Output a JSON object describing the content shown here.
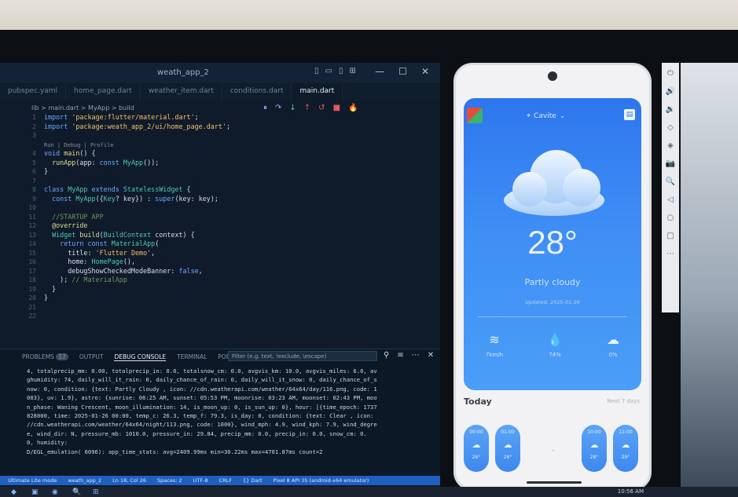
{
  "ide": {
    "title": "weath_app_2",
    "layout_icons": [
      "sidebar-left-icon",
      "panel-icon",
      "sidebar-right-icon",
      "layout-icon"
    ],
    "window_controls": [
      "—",
      "☐",
      "✕"
    ],
    "tabs": [
      "pubspec.yaml",
      "home_page.dart",
      "weather_item.dart",
      "conditions.dart",
      "main.dart"
    ],
    "breadcrumb": "lib > main.dart > MyApp > build",
    "debug_controls": [
      "⏸",
      "↷",
      "↓",
      "↑",
      "↺",
      "■",
      "🔥"
    ],
    "code_lines": [
      {
        "n": "1",
        "html": "<span class='kw'>import</span> <span class='st'>'package:flutter/material.dart'</span>;"
      },
      {
        "n": "2",
        "html": "<span class='kw'>import</span> <span class='st'>'package:weath_app_2/ui/home_page.dart'</span>;"
      },
      {
        "n": "3",
        "html": ""
      },
      {
        "n": "",
        "html": "<span class='codelens'>Run | Debug | Profile</span>"
      },
      {
        "n": "4",
        "html": "<span class='kw'>void</span> <span class='fn'>main</span>() {"
      },
      {
        "n": "5",
        "html": "  <span class='fn'>runApp</span>(app: <span class='kw'>const</span> <span class='ty'>MyApp</span>());"
      },
      {
        "n": "6",
        "html": "}"
      },
      {
        "n": "7",
        "html": ""
      },
      {
        "n": "8",
        "html": "<span class='kw'>class</span> <span class='ty'>MyApp</span> <span class='kw'>extends</span> <span class='ty'>StatelessWidget</span> {"
      },
      {
        "n": "9",
        "html": "  <span class='kw'>const</span> <span class='ty'>MyApp</span>({<span class='ty'>Key</span>? key}) : <span class='kw'>super</span>(key: key);"
      },
      {
        "n": "10",
        "html": ""
      },
      {
        "n": "11",
        "html": "  <span class='cm'>//STARTUP APP</span>"
      },
      {
        "n": "12",
        "html": "  <span class='fn'>@override</span>"
      },
      {
        "n": "13",
        "html": "  <span class='ty'>Widget</span> <span class='fn'>build</span>(<span class='ty'>BuildContext</span> context) {"
      },
      {
        "n": "14",
        "html": "    <span class='kw'>return const</span> <span class='ty'>MaterialApp</span>("
      },
      {
        "n": "15",
        "html": "      title: <span class='st'>'Flutter Demo'</span>,"
      },
      {
        "n": "16",
        "html": "      home: <span class='ty'>HomePage</span>(),"
      },
      {
        "n": "17",
        "html": "      debugShowCheckedModeBanner: <span class='kw'>false</span>,"
      },
      {
        "n": "18",
        "html": "    ); <span class='cm'>// MaterialApp</span>"
      },
      {
        "n": "19",
        "html": "  }"
      },
      {
        "n": "20",
        "html": "}"
      },
      {
        "n": "21",
        "html": ""
      },
      {
        "n": "22",
        "html": ""
      }
    ],
    "panel": {
      "tabs": [
        "PROBLEMS",
        "OUTPUT",
        "DEBUG CONSOLE",
        "TERMINAL",
        "PORTS"
      ],
      "problems_count": "17",
      "filter_placeholder": "Filter (e.g. text, !exclude, \\escape)",
      "console_lines": [
        "4, totalprecip_mm: 0.00, totalprecip_in: 0.0, totalsnow_cm: 0.0, avgvis_km: 10.0, avgvis_miles: 6.0, av",
        "ghumidity: 74, daily_will_it_rain: 0, daily_chance_of_rain: 0, daily_will_it_snow: 0, daily_chance_of_s",
        "now: 0, condition: {text: Partly Cloudy , icon: //cdn.weatherapi.com/weather/64x64/day/116.png, code: 1",
        "003}, uv: 1.9}, astro: {sunrise: 06:25 AM, sunset: 05:53 PM, moonrise: 03:23 AM, moonset: 02:43 PM, moo",
        "n_phase: Waning Crescent, moon_illumination: 14, is_moon_up: 0, is_sun_up: 0}, hour: [{time_epoch: 1737",
        "828000, time: 2025-01-26 00:00, temp_c: 26.3, temp_f: 79.3, is_day: 0, condition: {text: Clear , icon:",
        "//cdn.weatherapi.com/weather/64x64/night/113.png, code: 1000}, wind_mph: 4.9, wind_kph: 7.9, wind_degre",
        "e, wind_dir: N, pressure_mb: 1010.0, pressure_in: 29.84, precip_mm: 0.0, precip_in: 0.0, snow_cm: 0.",
        "0, humidity:",
        "D/EGL_emulation( 6096): app_time_stats: avg=2409.99ms min=30.22ms max=4701.87ms count=2"
      ]
    },
    "status_items": [
      "Ultimate Lite mode",
      "weath_app_2",
      "Ln 18, Col 26",
      "Spaces: 2",
      "UTF-8",
      "CRLF",
      "{} Dart",
      "Pixel 8 API 35 (android-x64 emulator)"
    ]
  },
  "phone": {
    "location": "Cavite",
    "temperature": "28°",
    "condition": "Partly cloudy",
    "updated": "Updated: 2025-01-26",
    "stats": [
      {
        "icon": "wind-icon",
        "glyph": "≋",
        "label": "7km/h"
      },
      {
        "icon": "humidity-icon",
        "glyph": "💧",
        "label": "74%"
      },
      {
        "icon": "cloud-icon",
        "glyph": "☁",
        "label": "0%"
      }
    ],
    "today_label": "Today",
    "next_label": "Next 7 days",
    "hours": [
      {
        "time": "00:00",
        "temp": "26°"
      },
      {
        "time": "01:00",
        "temp": "26°"
      },
      {
        "time": "",
        "temp": ""
      },
      {
        "time": "10:00",
        "temp": "28°"
      },
      {
        "time": "11:00",
        "temp": "29°"
      }
    ]
  },
  "emulator_tools": [
    "⏻",
    "🔊",
    "🔉",
    "◇",
    "◈",
    "📷",
    "🔍",
    "◁",
    "○",
    "□",
    "⋯"
  ],
  "taskbar": {
    "icons": [
      "⊞",
      "🔍",
      "◉",
      "▣",
      "◆"
    ],
    "clock": "10:56 AM"
  },
  "colors": {
    "accent": "#2d76ee",
    "statusbar": "#1f5fbf"
  }
}
